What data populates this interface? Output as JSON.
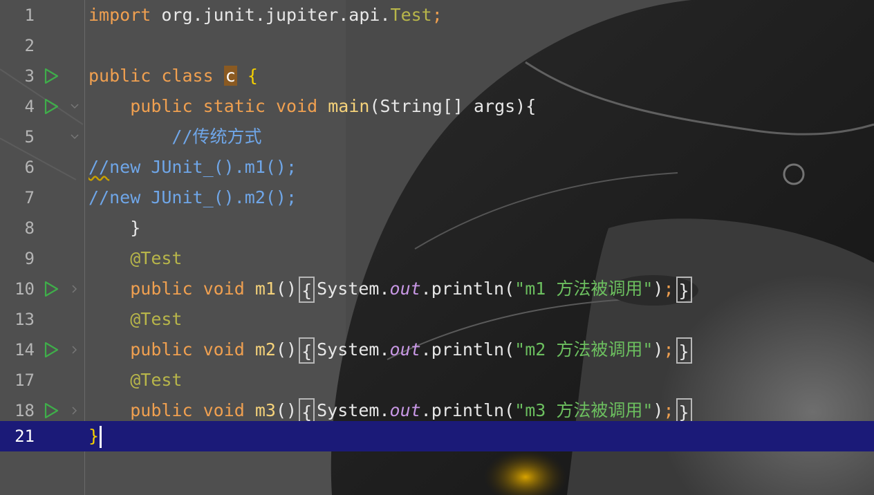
{
  "editor": {
    "language": "java",
    "lines": [
      {
        "num": "1",
        "import_kw": "import",
        "import_path": "org.junit.jupiter.api.",
        "import_name": "Test",
        "semi": ";"
      },
      {
        "num": "2"
      },
      {
        "num": "3",
        "kw1": "public",
        "kw2": "class",
        "class_name": "c",
        "brace": "{"
      },
      {
        "num": "4",
        "kw1": "public",
        "kw2": "static",
        "kw3": "void",
        "method": "main",
        "params": "(String[] args){"
      },
      {
        "num": "5",
        "comment": "//传统方式"
      },
      {
        "num": "6",
        "comment_slash": "//",
        "comment_rest": "new JUnit_().m1();"
      },
      {
        "num": "7",
        "comment": "//new JUnit_().m2();"
      },
      {
        "num": "8",
        "brace": "}"
      },
      {
        "num": "9",
        "annotation": "@Test"
      },
      {
        "num": "10",
        "kw1": "public",
        "kw2": "void",
        "method": "m1",
        "parens": "()",
        "open": "{",
        "sys": "System.",
        "field": "out",
        "call": ".println(",
        "str": "\"m1 方法被调用\"",
        "close_paren": ")",
        "semi": ";",
        "close": "}"
      },
      {
        "num": "13",
        "annotation": "@Test"
      },
      {
        "num": "14",
        "kw1": "public",
        "kw2": "void",
        "method": "m2",
        "parens": "()",
        "open": "{",
        "sys": "System.",
        "field": "out",
        "call": ".println(",
        "str": "\"m2 方法被调用\"",
        "close_paren": ")",
        "semi": ";",
        "close": "}"
      },
      {
        "num": "17",
        "annotation": "@Test"
      },
      {
        "num": "18",
        "kw1": "public",
        "kw2": "void",
        "method": "m3",
        "parens": "()",
        "open": "{",
        "sys": "System.",
        "field": "out",
        "call": ".println(",
        "str": "\"m3 方法被调用\"",
        "close_paren": ")",
        "semi": ";",
        "close": "}"
      },
      {
        "num": "21",
        "brace": "}"
      }
    ]
  },
  "colors": {
    "keyword": "#f0a050",
    "method": "#f5d27a",
    "annotation": "#b8b64a",
    "comment": "#6fa6e8",
    "string": "#6cbf5f",
    "field": "#c998e6",
    "current_line": "#1b1a78",
    "run_icon": "#3fae4a"
  },
  "icons": {
    "run": "run-gutter-icon",
    "fold": "fold-chevron-icon"
  }
}
